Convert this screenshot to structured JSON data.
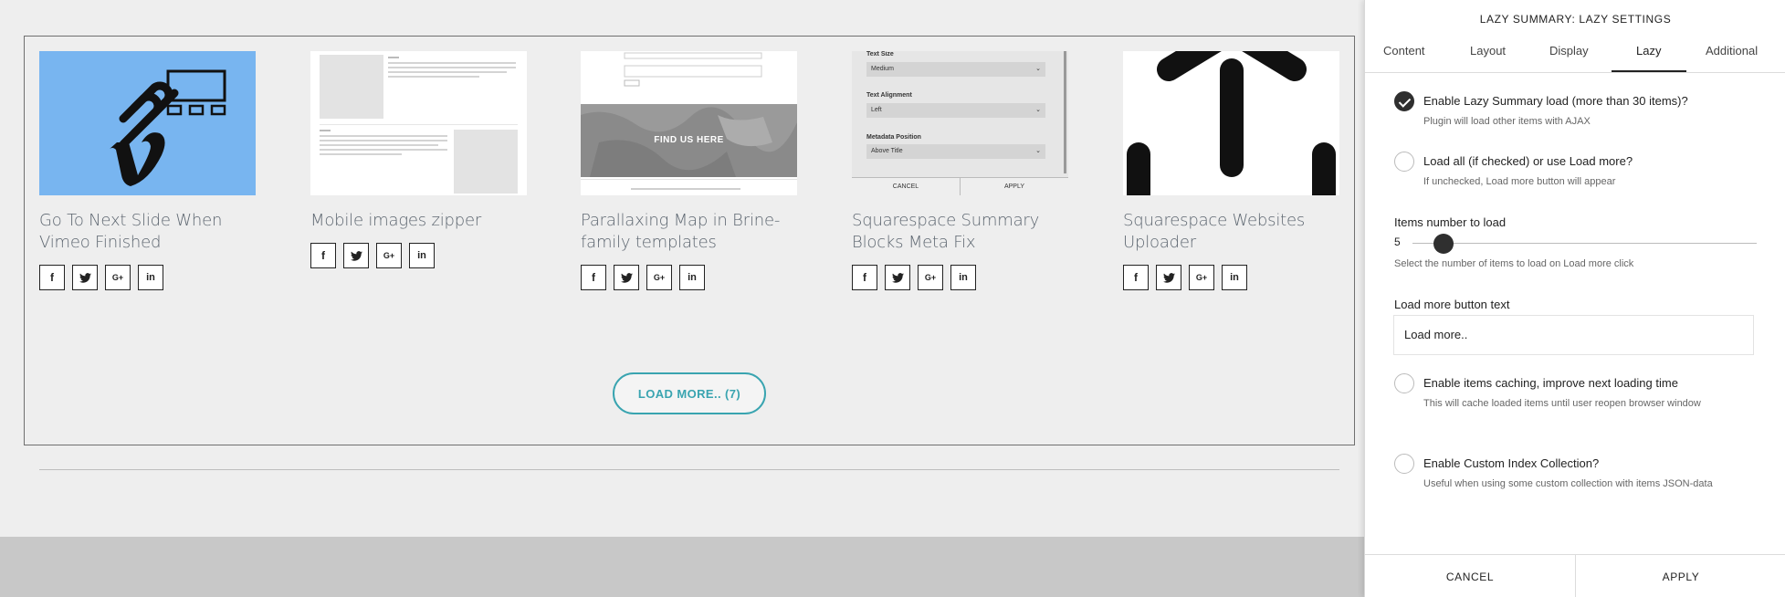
{
  "cards": [
    {
      "title": "Go To Next Slide When Vimeo Finished"
    },
    {
      "title": "Mobile images zipper"
    },
    {
      "title": "Parallaxing Map in Brine-family templates",
      "map_overlay": "FIND US HERE"
    },
    {
      "title": "Squarespace Summary Blocks Meta Fix",
      "form_labels": [
        "Text Size",
        "Text Alignment",
        "Metadata Position"
      ],
      "form_values": [
        "Medium",
        "Left",
        "Above Title"
      ],
      "form_buttons": [
        "CANCEL",
        "APPLY"
      ]
    },
    {
      "title": "Squarespace Websites Uploader"
    }
  ],
  "share": {
    "facebook": "f",
    "twitter": "t",
    "google": "G+",
    "linkedin": "in"
  },
  "load_more_button": "LOAD MORE.. (7)",
  "panel": {
    "title": "LAZY SUMMARY: LAZY SETTINGS",
    "tabs": [
      "Content",
      "Layout",
      "Display",
      "Lazy",
      "Additional"
    ],
    "active_tab": "Lazy",
    "options": [
      {
        "label": "Enable Lazy Summary load (more than 30 items)?",
        "desc": "Plugin will load other items with AJAX",
        "checked": true
      },
      {
        "label": "Load all (if checked) or use Load more?",
        "desc": "If unchecked, Load more button will appear",
        "checked": false
      },
      {
        "label": "Enable items caching, improve next loading time",
        "desc": "This will cache loaded items until user reopen browser window",
        "checked": false
      },
      {
        "label": "Enable Custom Index Collection?",
        "desc": "Useful when using some custom collection with items JSON-data",
        "checked": false
      }
    ],
    "items_number": {
      "label": "Items number to load",
      "value": "5",
      "desc": "Select the number of items to load on Load more click"
    },
    "load_more_text": {
      "label": "Load more button text",
      "value": "Load more.."
    },
    "cancel": "CANCEL",
    "apply": "APPLY"
  }
}
